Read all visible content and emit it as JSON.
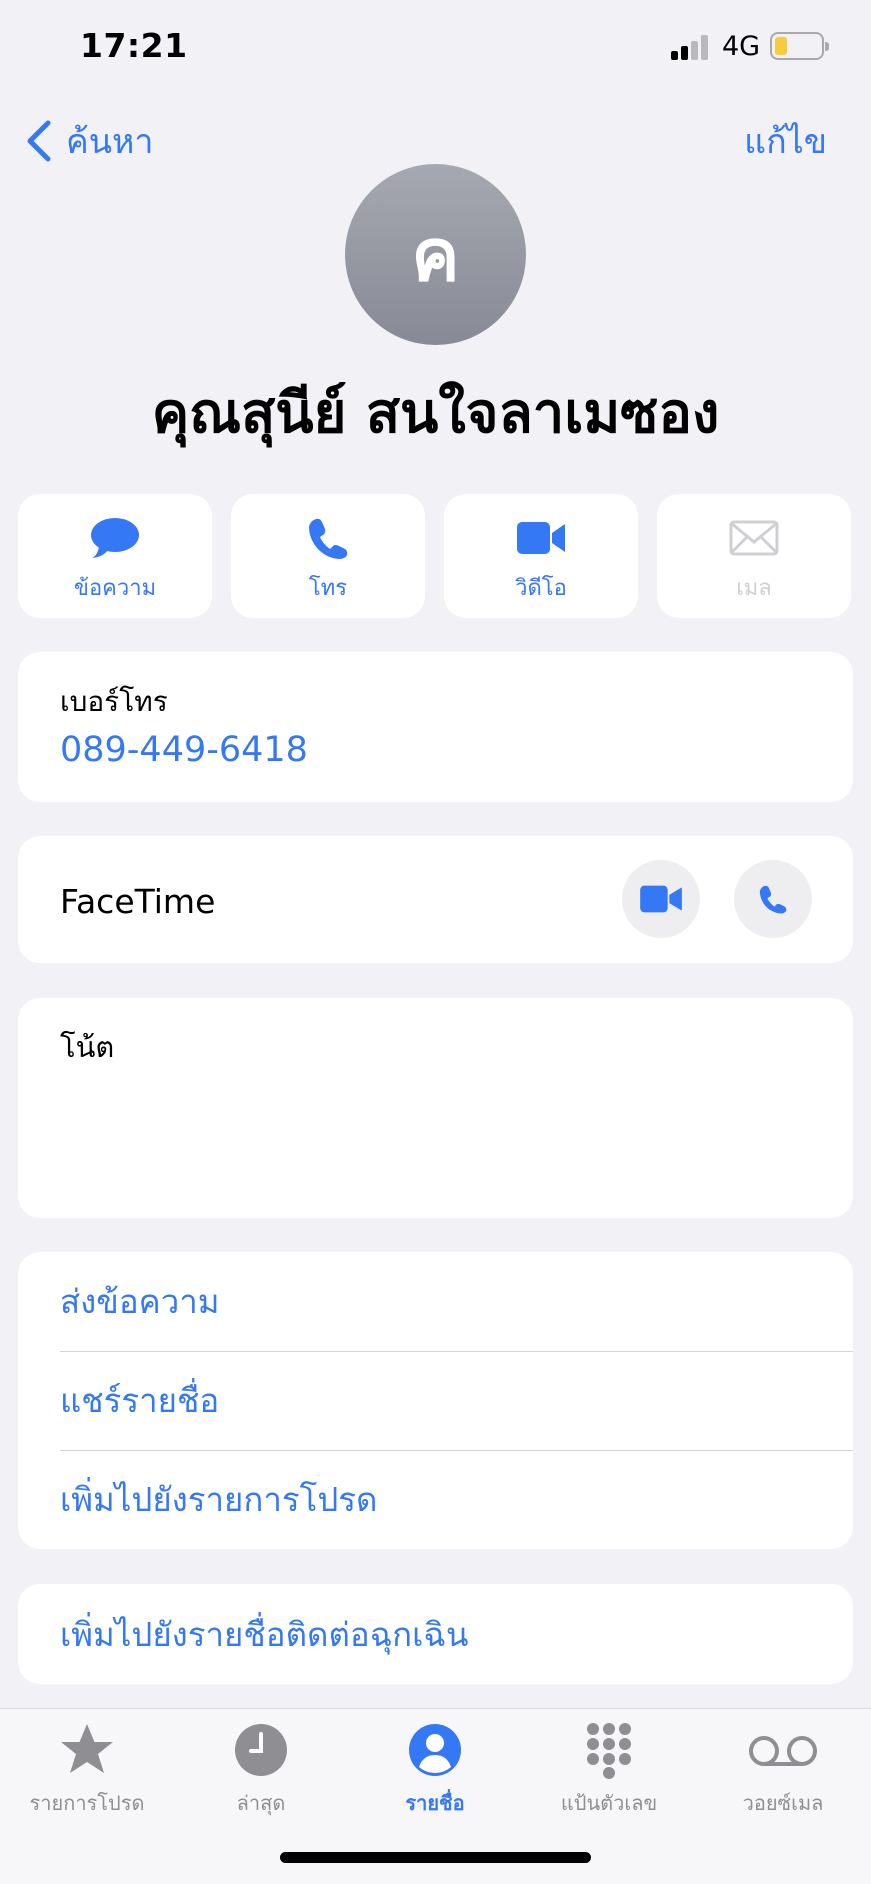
{
  "status_bar": {
    "time": "17:21",
    "network": "4G"
  },
  "nav": {
    "back_label": "ค้นหา",
    "edit_label": "แก้ไข"
  },
  "contact": {
    "initial": "ค",
    "name": "คุณสุนีย์ สนใจลาเมซอง"
  },
  "actions": [
    {
      "label": "ข้อความ",
      "icon": "message-icon",
      "enabled": true
    },
    {
      "label": "โทร",
      "icon": "phone-icon",
      "enabled": true
    },
    {
      "label": "วิดีโอ",
      "icon": "video-icon",
      "enabled": true
    },
    {
      "label": "เมล",
      "icon": "mail-icon",
      "enabled": false
    }
  ],
  "phone": {
    "caption": "เบอร์โทร",
    "number": "089-449-6418"
  },
  "facetime": {
    "label": "FaceTime"
  },
  "notes": {
    "label": "โน้ต"
  },
  "options": [
    "ส่งข้อความ",
    "แชร์รายชื่อ",
    "เพิ่มไปยังรายการโปรด"
  ],
  "emergency": {
    "label": "เพิ่มไปยังรายชื่อติดต่อฉุกเฉิน"
  },
  "tabs": [
    {
      "label": "รายการโปรด",
      "icon": "star-icon",
      "active": false
    },
    {
      "label": "ล่าสุด",
      "icon": "clock-icon",
      "active": false
    },
    {
      "label": "รายชื่อ",
      "icon": "person-circle-icon",
      "active": true
    },
    {
      "label": "แป้นตัวเลข",
      "icon": "keypad-icon",
      "active": false
    },
    {
      "label": "วอยซ์เมล",
      "icon": "voicemail-icon",
      "active": false
    }
  ],
  "colors": {
    "accent": "#3478f6",
    "background": "#f2f1f6",
    "inactive": "#8e8e93",
    "disabled": "#d0d0d4"
  }
}
